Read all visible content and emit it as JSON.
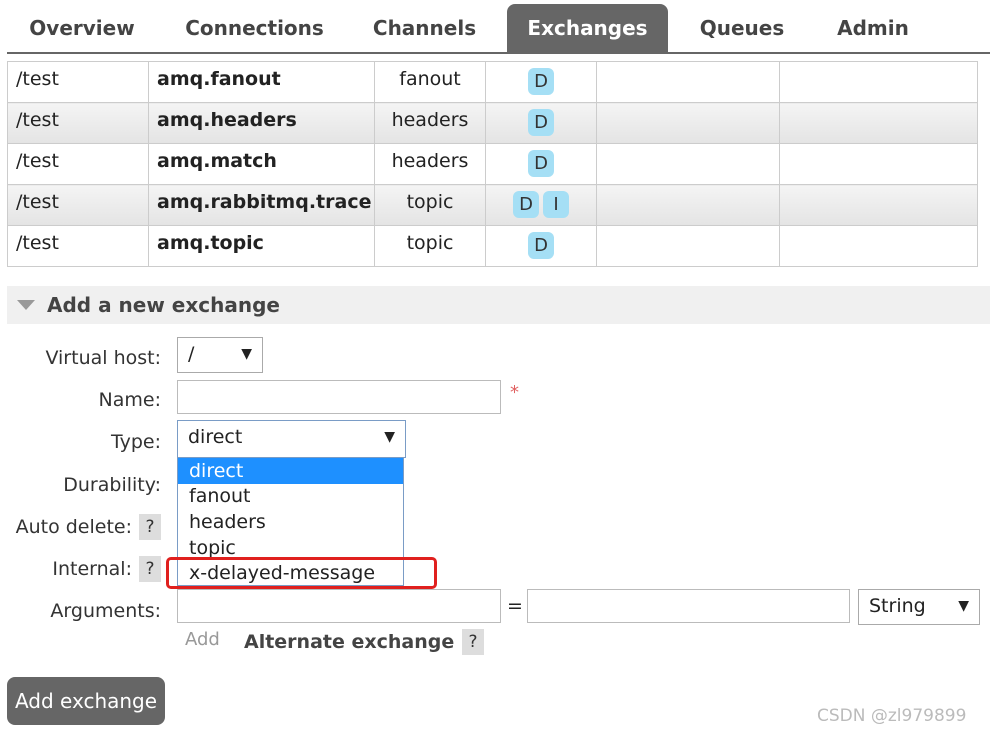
{
  "tabs": [
    "Overview",
    "Connections",
    "Channels",
    "Exchanges",
    "Queues",
    "Admin"
  ],
  "exchanges": [
    {
      "vhost": "/test",
      "name": "amq.fanout",
      "type": "fanout",
      "features": [
        "D"
      ]
    },
    {
      "vhost": "/test",
      "name": "amq.headers",
      "type": "headers",
      "features": [
        "D"
      ]
    },
    {
      "vhost": "/test",
      "name": "amq.match",
      "type": "headers",
      "features": [
        "D"
      ]
    },
    {
      "vhost": "/test",
      "name": "amq.rabbitmq.trace",
      "type": "topic",
      "features": [
        "D",
        "I"
      ]
    },
    {
      "vhost": "/test",
      "name": "amq.topic",
      "type": "topic",
      "features": [
        "D"
      ]
    }
  ],
  "section": {
    "title": "Add a new exchange",
    "icon": "triangle-down-icon"
  },
  "form": {
    "vhost_label": "Virtual host:",
    "vhost_value": "/",
    "name_label": "Name:",
    "required_mark": "*",
    "type_label": "Type:",
    "type_value": "direct",
    "type_options": [
      "direct",
      "fanout",
      "headers",
      "topic",
      "x-delayed-message"
    ],
    "durability_label": "Durability:",
    "autodelete_label": "Auto delete:",
    "internal_label": "Internal:",
    "arguments_label": "Arguments:",
    "equals": "=",
    "arg_type_value": "String",
    "help": "?",
    "add_link": "Add",
    "alt_exchange": "Alternate exchange",
    "dropdown_arrow": "▼"
  },
  "add_button": "Add exchange",
  "watermark": "CSDN @zl979899",
  "colors": {
    "badge": "#a5dff5",
    "tab_active": "#666666",
    "selected_option": "#1e90ff",
    "highlight_box": "#e0201e"
  }
}
